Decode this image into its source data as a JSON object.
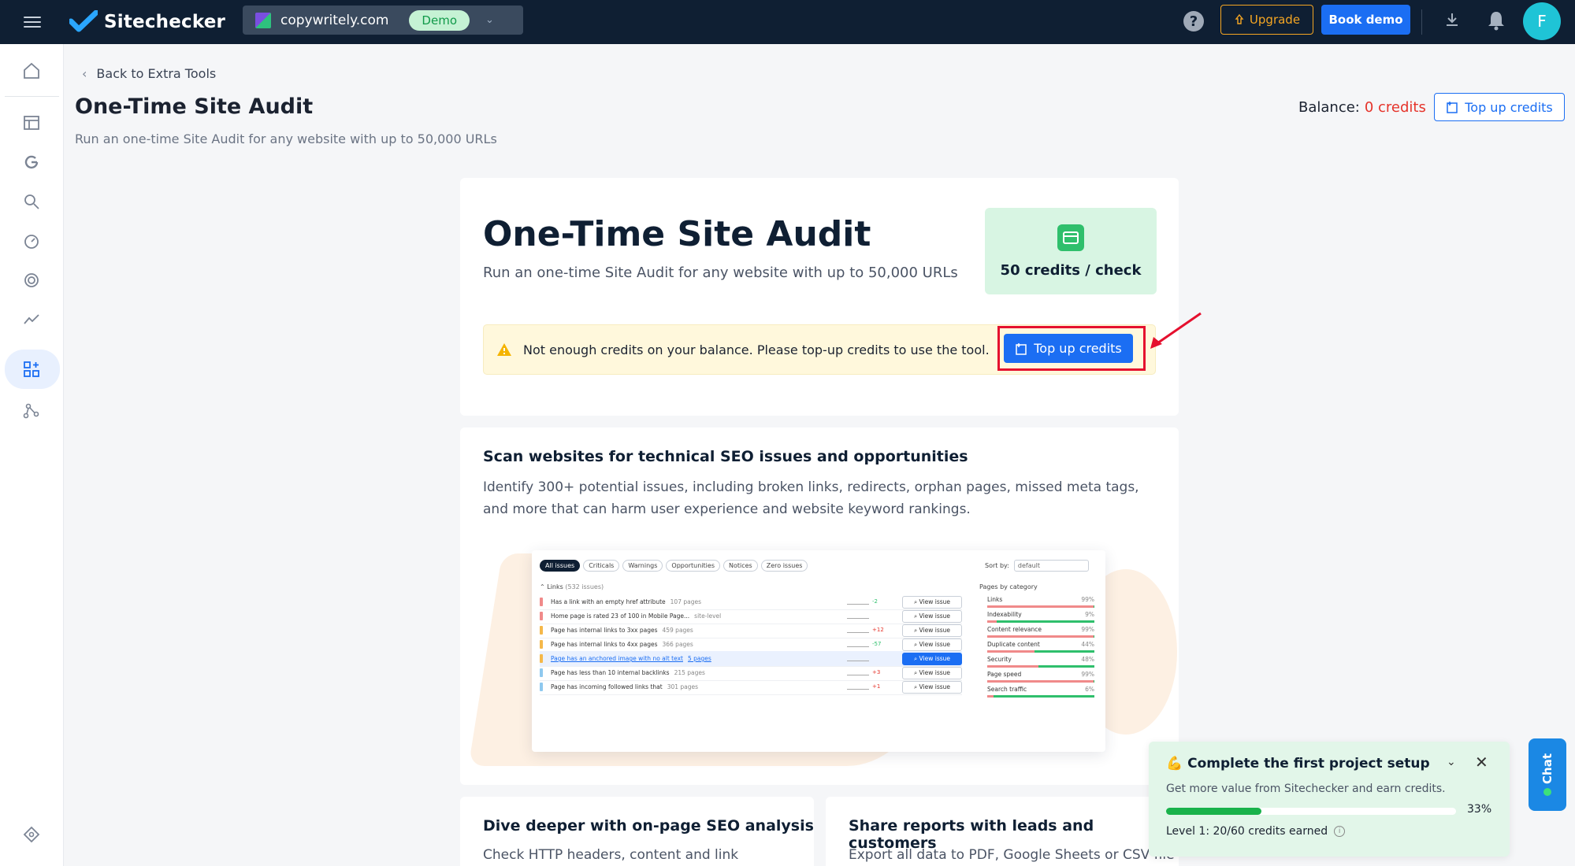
{
  "topbar": {
    "brand": "Sitechecker",
    "project": "copywritely.com",
    "project_badge": "Demo",
    "upgrade_label": "Upgrade",
    "book_demo_label": "Book demo",
    "avatar_initial": "F",
    "help_glyph": "?"
  },
  "sidebar": {
    "icons": [
      "home-icon",
      "dashboard-icon",
      "google-icon",
      "keyword-search-icon",
      "speed-gauge-icon",
      "target-icon",
      "trend-line-icon",
      "extra-tools-icon",
      "network-icon",
      "settings-icon"
    ],
    "active": "extra-tools-icon"
  },
  "header": {
    "back_label": "Back to Extra Tools",
    "title": "One-Time Site Audit",
    "subtitle": "Run an one-time Site Audit for any website with up to 50,000 URLs",
    "balance_label": "Balance:",
    "balance_value": "0 credits",
    "topup_label": "Top up credits"
  },
  "hero": {
    "title": "One-Time Site Audit",
    "subtitle": "Run an one-time Site Audit for any website with up to 50,000 URLs",
    "price_label": "50 credits / check",
    "warning_text": "Not enough credits on your balance. Please top-up credits to use the tool.",
    "topup_label": "Top up credits"
  },
  "scan": {
    "title": "Scan websites for technical SEO issues and opportunities",
    "description": "Identify 300+ potential issues, including broken links, redirects, orphan pages, missed meta tags, and more that can harm user experience and website keyword rankings.",
    "preview": {
      "chips": [
        "All issues",
        "Criticals",
        "Warnings",
        "Opportunities",
        "Notices",
        "Zero issues"
      ],
      "sort_label": "Sort by:",
      "sort_value": "default",
      "links_header": "Links",
      "links_count": "(532 issues)",
      "pages_by_category": "Pages by category",
      "view_label": "View issue",
      "issues": [
        {
          "text": "Has a link with an empty href attribute",
          "count": "107 pages",
          "color": "#f08a8a",
          "delta": "-2",
          "delta_color": "#2fbf6c"
        },
        {
          "text": "Home page is rated 23 of 100 in Mobile Page...",
          "count": "site-level",
          "color": "#f08a8a",
          "delta": "",
          "delta_color": "#888"
        },
        {
          "text": "Page has internal links to 3xx pages",
          "count": "459 pages",
          "color": "#f5b84a",
          "delta": "+12",
          "delta_color": "#e5332a"
        },
        {
          "text": "Page has internal links to 4xx pages",
          "count": "366 pages",
          "color": "#f5b84a",
          "delta": "-57",
          "delta_color": "#2fbf6c"
        },
        {
          "text": "Page has an anchored image with no alt text",
          "count": "5 pages",
          "color": "#f5b84a",
          "delta": "",
          "delta_color": "#888"
        },
        {
          "text": "Page has less than 10 internal backlinks",
          "count": "215 pages",
          "color": "#8fc9ef",
          "delta": "+3",
          "delta_color": "#e5332a"
        },
        {
          "text": "Page has incoming followed links that",
          "count": "301 pages",
          "color": "#8fc9ef",
          "delta": "+1",
          "delta_color": "#e5332a"
        }
      ],
      "categories": [
        {
          "name": "Links",
          "pct": "99%",
          "value": 0.99
        },
        {
          "name": "Indexability",
          "pct": "9%",
          "value": 0.09
        },
        {
          "name": "Content relevance",
          "pct": "99%",
          "value": 0.99
        },
        {
          "name": "Duplicate content",
          "pct": "44%",
          "value": 0.44
        },
        {
          "name": "Security",
          "pct": "48%",
          "value": 0.48
        },
        {
          "name": "Page speed",
          "pct": "99%",
          "value": 0.99
        },
        {
          "name": "Search traffic",
          "pct": "6%",
          "value": 0.06
        }
      ]
    }
  },
  "feature_left": {
    "title": "Dive deeper with on-page SEO analysis",
    "description": "Check HTTP headers, content and link"
  },
  "feature_right": {
    "title": "Share reports with leads and customers",
    "description": "Export all data to PDF, Google Sheets or CSV file"
  },
  "setup_widget": {
    "emoji": "💪",
    "title": "Complete the first project setup",
    "description": "Get more value from Sitechecker and earn credits.",
    "progress": 0.33,
    "progress_label": "33%",
    "level_label": "Level 1: 20/60 credits earned"
  },
  "chat": {
    "label": "Chat"
  },
  "colors": {
    "accent": "#1b6ef3",
    "danger": "#e5332a",
    "topbar": "#0f1f33",
    "success": "#2fbf6c"
  }
}
